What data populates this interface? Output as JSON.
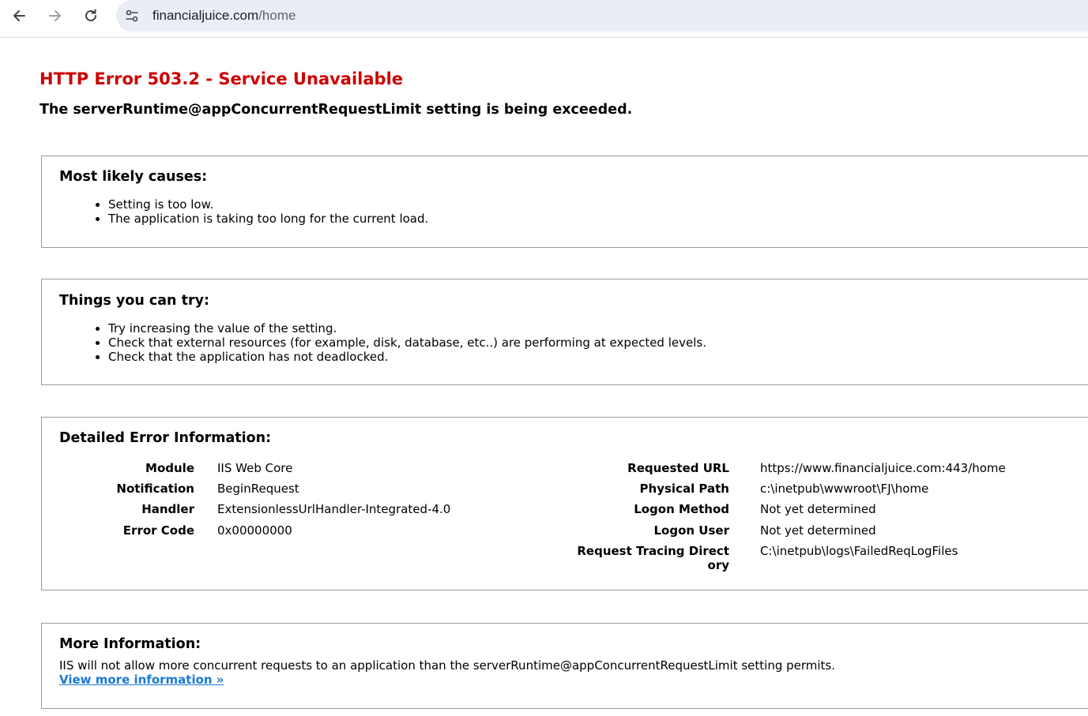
{
  "browser": {
    "url_host": "financialjuice.com",
    "url_path": "/home",
    "icons": [
      "back-arrow-icon",
      "forward-arrow-icon",
      "reload-icon",
      "site-info-icon"
    ]
  },
  "page": {
    "title": "HTTP Error 503.2 - Service Unavailable",
    "subtitle": "The serverRuntime@appConcurrentRequestLimit setting is being exceeded.",
    "title_color": "#cc0000"
  },
  "causes": {
    "heading": "Most likely causes:",
    "items": [
      "Setting is too low.",
      "The application is taking too long for the current load."
    ]
  },
  "try": {
    "heading": "Things you can try:",
    "items": [
      "Try increasing the value of the setting.",
      "Check that external resources (for example, disk, database, etc..) are performing at expected levels.",
      "Check that the application has not deadlocked."
    ]
  },
  "details": {
    "heading": "Detailed Error Information:",
    "left": [
      {
        "label": "Module",
        "value": "IIS Web Core"
      },
      {
        "label": "Notification",
        "value": "BeginRequest"
      },
      {
        "label": "Handler",
        "value": "ExtensionlessUrlHandler-Integrated-4.0"
      },
      {
        "label": "Error Code",
        "value": "0x00000000"
      }
    ],
    "right": [
      {
        "label": "Requested URL",
        "value": "https://www.financialjuice.com:443/home"
      },
      {
        "label": "Physical Path",
        "value": "c:\\inetpub\\wwwroot\\FJ\\home"
      },
      {
        "label": "Logon Method",
        "value": "Not yet determined"
      },
      {
        "label": "Logon User",
        "value": "Not yet determined"
      },
      {
        "label_line1": "Request Tracing Direct",
        "label_line2": "ory",
        "value": "C:\\inetpub\\logs\\FailedReqLogFiles"
      }
    ]
  },
  "more": {
    "heading": "More Information:",
    "text": "IIS will not allow more concurrent requests to an application than the serverRuntime@appConcurrentRequestLimit setting permits.",
    "link": "View more information »",
    "link_color": "#1a7ad7"
  }
}
